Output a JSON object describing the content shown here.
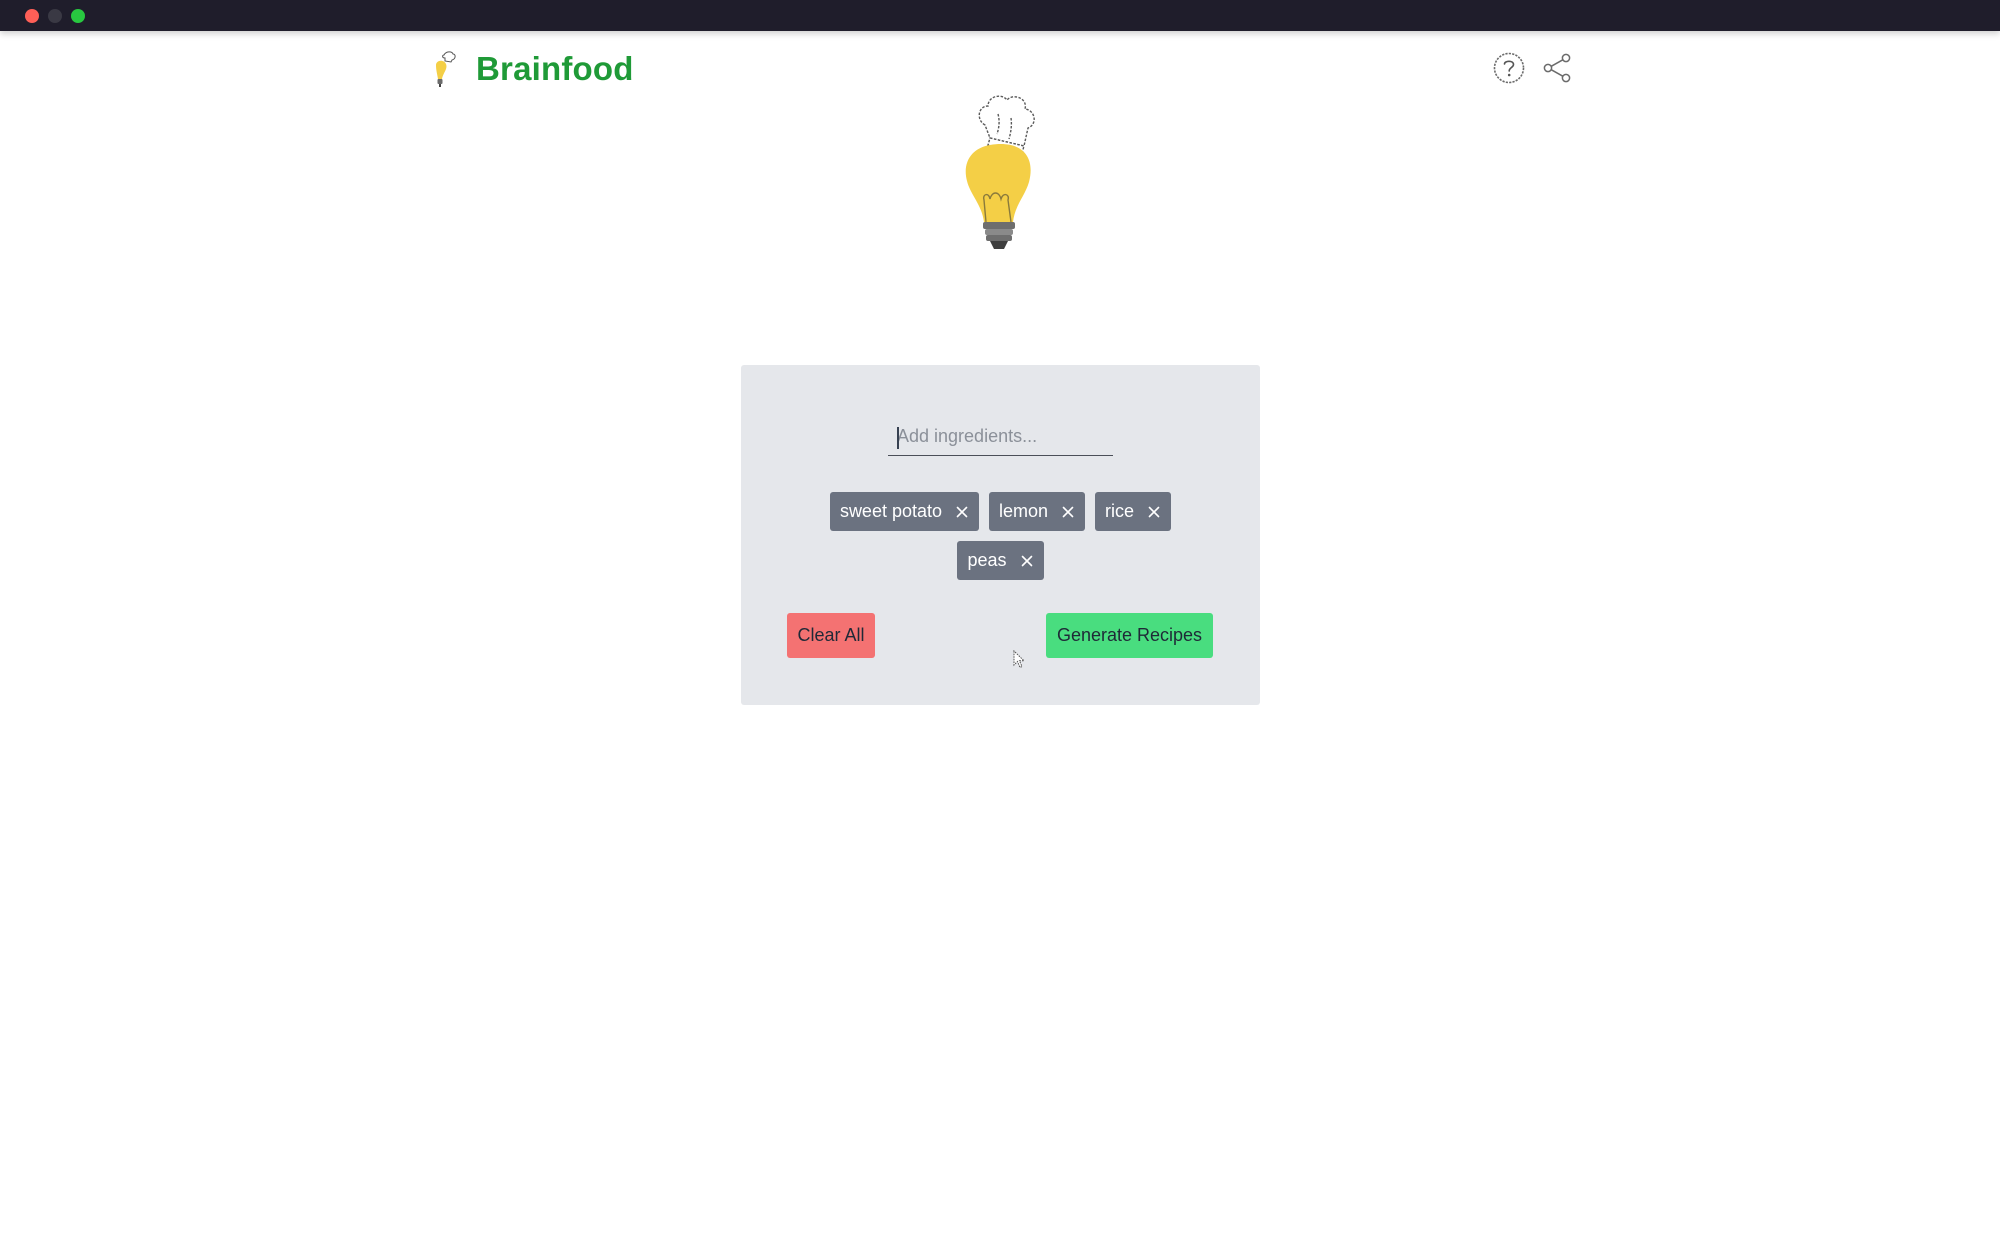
{
  "window": {
    "traffic_lights": [
      "close",
      "minimize",
      "zoom"
    ]
  },
  "header": {
    "brand": "Brainfood",
    "brand_color": "#1f9a37",
    "icons": [
      "help-icon",
      "share-icon"
    ]
  },
  "hero": {
    "icon": "lightbulb-chef-hat-icon"
  },
  "form": {
    "input_placeholder": "Add ingredients...",
    "input_value": "",
    "ingredients": [
      "sweet potato",
      "lemon",
      "rice",
      "peas"
    ],
    "clear_label": "Clear All",
    "generate_label": "Generate Recipes",
    "card_color": "#e5e7eb",
    "tag_color": "#6b7280",
    "clear_color": "#f47272",
    "generate_color": "#49dd7f"
  }
}
